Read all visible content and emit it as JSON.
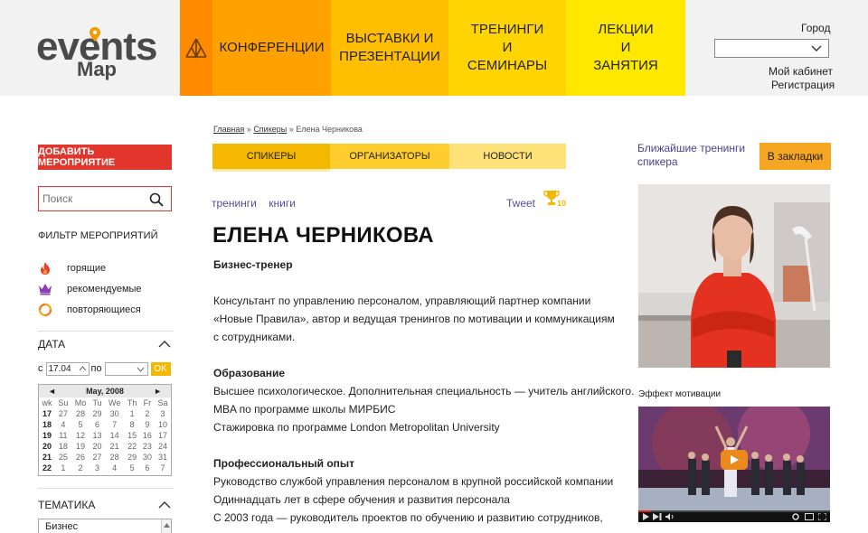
{
  "logo": {
    "text_top": "events",
    "text_bottom": "Map"
  },
  "nav": {
    "items": [
      {
        "label": "КОНФЕРЕНЦИИ",
        "color": "#FFA200"
      },
      {
        "label": "ВЫСТАВКИ И ПРЕЗЕНТАЦИИ",
        "color": "#FFBE00"
      },
      {
        "label": "ТРЕНИНГИ И СЕМИНАРЫ",
        "color": "#FFD400"
      },
      {
        "label": "ЛЕКЦИИ И ЗАНЯТИЯ",
        "color": "#FFE800"
      }
    ],
    "active_color": "#FF8A00"
  },
  "header_right": {
    "city_label": "Город",
    "city_value": "",
    "cabinet": "Мой кабинет",
    "register": "Регистрация"
  },
  "sidebar": {
    "add_button": "ДОБАВИТЬ МЕРОПРИЯТИЕ",
    "search_placeholder": "Поиск",
    "filter_title": "ФИЛЬТР МЕРОПРИЯТИЙ",
    "filters": [
      {
        "label": "горящие",
        "icon": "flame-icon"
      },
      {
        "label": "рекомендуемые",
        "icon": "crown-icon"
      },
      {
        "label": "повторяющиеся",
        "icon": "repeat-icon"
      }
    ],
    "date_title": "ДАТА",
    "date_from_prefix": "с",
    "date_from": "17.04",
    "date_to_prefix": "по",
    "date_to": "",
    "ok": "OK",
    "theme_title": "ТЕМАТИКА",
    "theme_first": "Бизнес"
  },
  "calendar": {
    "month": "May, 2008",
    "prev": "◄",
    "next": "►",
    "days": [
      "wk",
      "Su",
      "Mo",
      "Tu",
      "We",
      "Th",
      "Fr",
      "Sa"
    ],
    "weeks": [
      [
        "17",
        "27",
        "28",
        "29",
        "30",
        "1",
        "2",
        "3"
      ],
      [
        "18",
        "4",
        "5",
        "6",
        "7",
        "8",
        "9",
        "10"
      ],
      [
        "19",
        "11",
        "12",
        "13",
        "14",
        "15",
        "16",
        "17"
      ],
      [
        "20",
        "18",
        "19",
        "20",
        "21",
        "22",
        "23",
        "24"
      ],
      [
        "21",
        "25",
        "26",
        "27",
        "28",
        "29",
        "30",
        "31"
      ],
      [
        "22",
        "1",
        "2",
        "3",
        "4",
        "5",
        "6",
        "7"
      ]
    ]
  },
  "breadcrumb": {
    "home": "Главная",
    "sep": "»",
    "speakers": "Спикеры",
    "current": "Елена Черникова"
  },
  "subtabs": [
    {
      "label": "СПИКЕРЫ",
      "color": "#F5B800"
    },
    {
      "label": "ОРГАНИЗАТОРЫ",
      "color": "#FFCD2E"
    },
    {
      "label": "НОВОСТИ",
      "color": "#FFE27A"
    }
  ],
  "tags": [
    "тренинги",
    "книги"
  ],
  "tweet": "Tweet",
  "trophy_count": "10",
  "speaker": {
    "name": "ЕЛЕНА ЧЕРНИКОВА",
    "role": "Бизнес-тренер",
    "intro": [
      "Консультант по управлению персоналом, управляющий партнер компании",
      "«Новые Правила», автор и ведущая тренингов по мотивации и коммуникациям",
      "с сотрудниками."
    ],
    "education_title": "Образование",
    "education": [
      "Высшее психологическое. Дополнительная специальность — учитель английского.",
      "MBA по программе школы МИРБИС",
      "Стажировка по программе London Metropolitan University"
    ],
    "experience_title": "Профессиональный опыт",
    "experience": [
      "Руководство службой управления персоналом в крупной российской компании",
      "Одиннадцать лет в сфере обучения и развития персонала",
      "С 2003 года — руководитель проектов по обучению и развитию сотрудников,"
    ]
  },
  "right": {
    "nearest": "Ближайшие тренинги спикера",
    "bookmark": "В закладки",
    "video_label": "Эффект мотивации"
  }
}
